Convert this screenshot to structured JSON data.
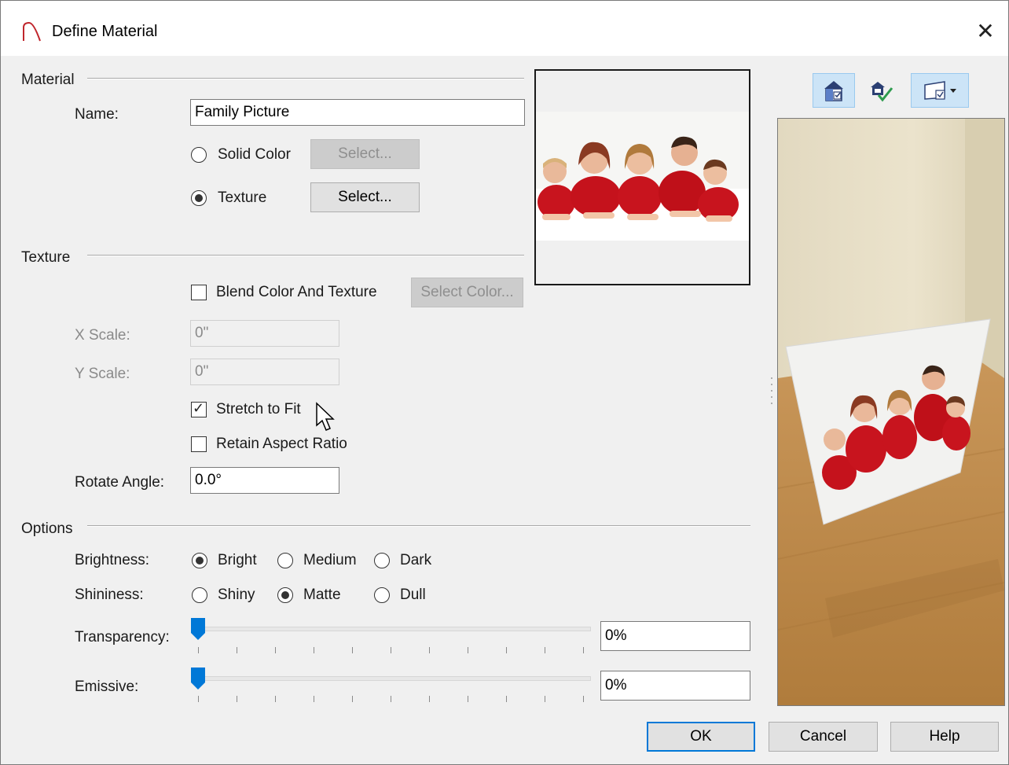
{
  "window": {
    "title": "Define Material",
    "close_glyph": "✕"
  },
  "material": {
    "section_label": "Material",
    "name_label": "Name:",
    "name_value": "Family Picture",
    "solid_color_label": "Solid Color",
    "texture_label": "Texture",
    "solid_select_label": "Select...",
    "texture_select_label": "Select...",
    "selected": "Texture"
  },
  "texture": {
    "section_label": "Texture",
    "blend_label": "Blend Color And Texture",
    "blend_checked": false,
    "select_color_label": "Select Color...",
    "x_scale_label": "X Scale:",
    "x_scale_value": "0\"",
    "y_scale_label": "Y Scale:",
    "y_scale_value": "0\"",
    "stretch_label": "Stretch to Fit",
    "stretch_checked": true,
    "retain_label": "Retain Aspect Ratio",
    "retain_checked": false,
    "rotate_label": "Rotate Angle:",
    "rotate_value": "0.0°"
  },
  "options": {
    "section_label": "Options",
    "brightness_label": "Brightness:",
    "brightness_options": [
      "Bright",
      "Medium",
      "Dark"
    ],
    "brightness_selected": "Bright",
    "shininess_label": "Shininess:",
    "shininess_options": [
      "Shiny",
      "Matte",
      "Dull"
    ],
    "shininess_selected": "Matte",
    "transparency_label": "Transparency:",
    "transparency_value": "0%",
    "transparency_level": 0,
    "emissive_label": "Emissive:",
    "emissive_value": "0%",
    "emissive_level": 0
  },
  "toolbar": {
    "icons": [
      "room-view-icon",
      "check-view-icon",
      "preview-options-icon"
    ]
  },
  "buttons": {
    "ok": "OK",
    "cancel": "Cancel",
    "help": "Help"
  },
  "colors": {
    "accent": "#0078d7",
    "shirt_red": "#c8141e",
    "floor": "#b98a45",
    "wall": "#e8dfc8"
  }
}
